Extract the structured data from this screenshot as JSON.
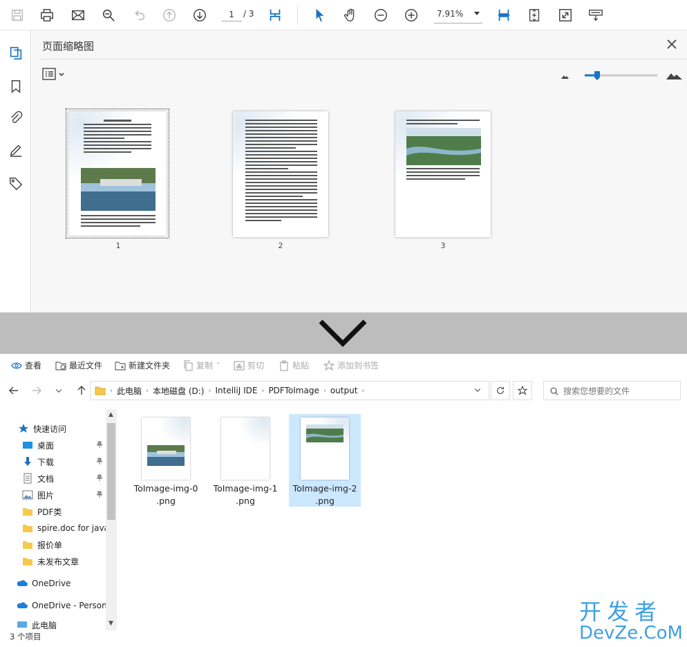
{
  "reader": {
    "page_current": "1",
    "page_total": "/ 3",
    "zoom": "7.91%",
    "panel_title": "页面缩略图",
    "thumbnails": [
      {
        "label": "1"
      },
      {
        "label": "2"
      },
      {
        "label": "3"
      }
    ]
  },
  "explorer": {
    "commands": {
      "view": "查看",
      "recent": "最近文件",
      "new_folder": "新建文件夹",
      "copy": "复制",
      "cut": "剪切",
      "paste": "粘贴",
      "bookmark": "添加到书签"
    },
    "breadcrumbs": [
      "此电脑",
      "本地磁盘 (D:)",
      "IntelliJ IDE",
      "PDFToImage",
      "output"
    ],
    "search_placeholder": "搜索您想要的文件",
    "nav": {
      "quick_access": "快速访问",
      "items": [
        "桌面",
        "下载",
        "文档",
        "图片",
        "PDF类",
        "spire.doc for java",
        "报价单",
        "未发布文章"
      ],
      "onedrive": "OneDrive",
      "onedrive_personal": "OneDrive - Personal",
      "this_pc": "此电脑"
    },
    "files": [
      {
        "name_l1": "ToImage-img-0",
        "name_l2": ".png"
      },
      {
        "name_l1": "ToImage-img-1",
        "name_l2": ".png"
      },
      {
        "name_l1": "ToImage-img-2",
        "name_l2": ".png"
      }
    ],
    "status": "3 个项目"
  },
  "watermark": {
    "line1": "开发者",
    "line2": "DevZe.CoM"
  },
  "colors": {
    "accent": "#1a73c6",
    "selection": "#cce8ff",
    "divider": "#bdbdbd",
    "watermark": "#3ea0e2"
  }
}
